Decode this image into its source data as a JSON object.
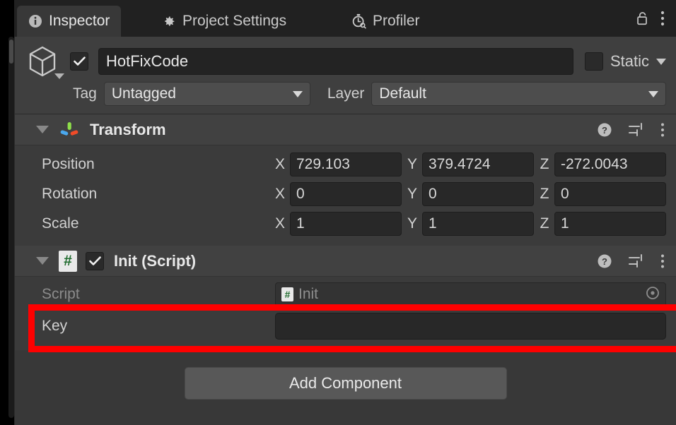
{
  "window": {
    "tabs": [
      {
        "label": "Inspector",
        "icon": "info-icon",
        "active": true
      },
      {
        "label": "Project Settings",
        "icon": "gear-icon",
        "active": false
      },
      {
        "label": "Profiler",
        "icon": "stopwatch-icon",
        "active": false
      }
    ],
    "lock_icon": "unlocked-padlock-icon",
    "menu_icon": "kebab-menu-icon"
  },
  "game_object": {
    "icon": "cube-icon",
    "enabled_checkbox": {
      "checked": true,
      "mark": "✓"
    },
    "name": "HotFixCode",
    "name_placeholder": "Name",
    "static": {
      "label": "Static",
      "checked": false
    },
    "tag": {
      "label": "Tag",
      "value": "Untagged"
    },
    "layer": {
      "label": "Layer",
      "value": "Default"
    }
  },
  "components": [
    {
      "title": "Transform",
      "icon": "transform-gizmo-icon",
      "expanded": true,
      "actions": [
        "help-icon",
        "preset-icon",
        "kebab-menu-icon"
      ],
      "rows": [
        {
          "label": "Position",
          "type": "vector3",
          "axes": [
            "X",
            "Y",
            "Z"
          ],
          "values": [
            "729.103",
            "379.4724",
            "-272.0043"
          ]
        },
        {
          "label": "Rotation",
          "type": "vector3",
          "axes": [
            "X",
            "Y",
            "Z"
          ],
          "values": [
            "0",
            "0",
            "0"
          ]
        },
        {
          "label": "Scale",
          "type": "vector3",
          "axes": [
            "X",
            "Y",
            "Z"
          ],
          "values": [
            "1",
            "1",
            "1"
          ]
        }
      ]
    },
    {
      "title": "Init (Script)",
      "icon": "csharp-script-icon",
      "expanded": true,
      "enabled_checkbox": {
        "checked": true,
        "mark": "✓"
      },
      "actions": [
        "help-icon",
        "preset-icon",
        "kebab-menu-icon"
      ],
      "rows": [
        {
          "label": "Script",
          "type": "object",
          "value": "Init",
          "icon": "csharp-script-icon",
          "picker": "object-picker-icon",
          "disabled": true
        },
        {
          "label": "Key",
          "type": "text",
          "value": ""
        }
      ]
    }
  ],
  "footer": {
    "add_component_label": "Add Component"
  },
  "annotation": {
    "color": "#fe0000",
    "target": "key-field-row"
  }
}
